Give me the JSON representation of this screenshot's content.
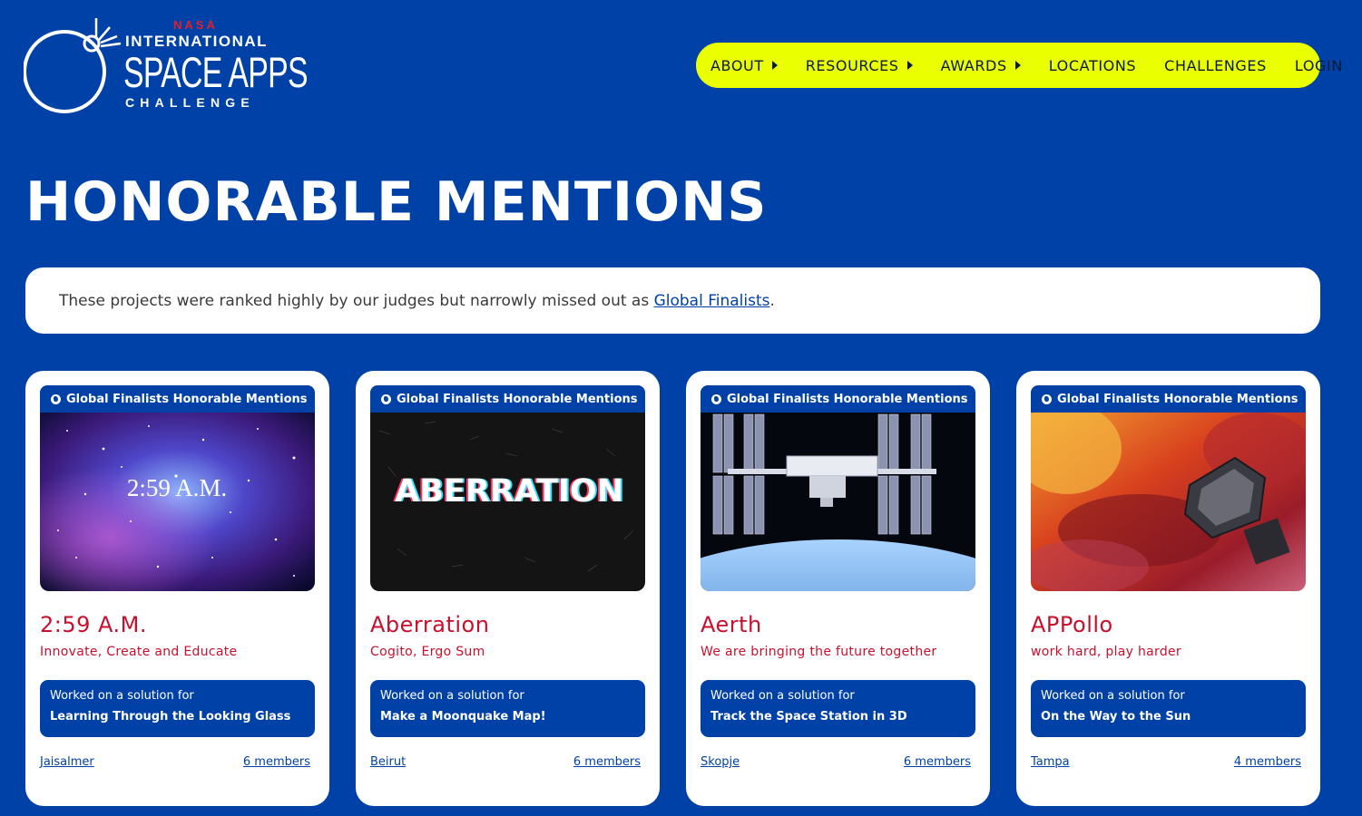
{
  "logo": {
    "nasa": "NASA",
    "line1": "INTERNATIONAL",
    "line2": "SPACE APPS",
    "line3": "CHALLENGE"
  },
  "nav": {
    "items": [
      {
        "label": "ABOUT",
        "has_submenu": true
      },
      {
        "label": "RESOURCES",
        "has_submenu": true
      },
      {
        "label": "AWARDS",
        "has_submenu": true
      },
      {
        "label": "LOCATIONS",
        "has_submenu": false
      },
      {
        "label": "CHALLENGES",
        "has_submenu": false
      },
      {
        "label": "LOGIN",
        "has_submenu": false
      }
    ]
  },
  "page": {
    "title": "HONORABLE MENTIONS",
    "intro_text": "These projects were ranked highly by our judges but narrowly missed out as ",
    "intro_link": "Global Finalists",
    "intro_end": "."
  },
  "cards": [
    {
      "badge": "Global Finalists Honorable Mentions",
      "image_text": "2:59 A.M.",
      "title": "2:59 A.M.",
      "tagline": "Innovate, Create and Educate",
      "challenge_prefix": "Worked on a solution for",
      "challenge": "Learning Through the Looking Glass",
      "location": "Jaisalmer",
      "members": "6 members"
    },
    {
      "badge": "Global Finalists Honorable Mentions",
      "image_text": "ABERRATION",
      "title": "Aberration",
      "tagline": "Cogito, Ergo Sum",
      "challenge_prefix": "Worked on a solution for",
      "challenge": "Make a Moonquake Map!",
      "location": "Beirut",
      "members": "6 members"
    },
    {
      "badge": "Global Finalists Honorable Mentions",
      "title": "Aerth",
      "tagline": "We are bringing the future together",
      "challenge_prefix": "Worked on a solution for",
      "challenge": "Track the Space Station in 3D",
      "location": "Skopje",
      "members": "6 members"
    },
    {
      "badge": "Global Finalists Honorable Mentions",
      "title": "APPollo",
      "tagline": "work hard, play harder",
      "challenge_prefix": "Worked on a solution for",
      "challenge": "On the Way to the Sun",
      "location": "Tampa",
      "members": "4 members"
    }
  ],
  "colors": {
    "background": "#0041a8",
    "nav_bg": "#eaff00",
    "title_red": "#c8102e",
    "nasa_red": "#e0202c"
  }
}
